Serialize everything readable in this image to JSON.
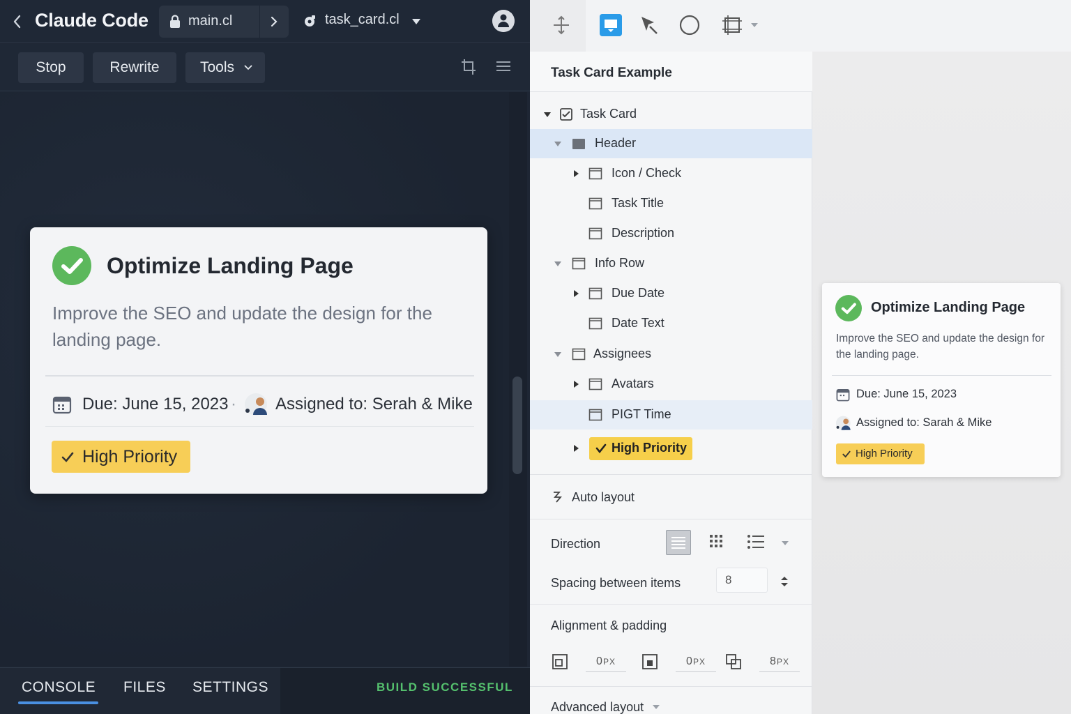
{
  "app": {
    "title": "Claude Code",
    "file_tab": "main.cl",
    "second_tab": "task_card.cl"
  },
  "toolbar": {
    "stop_label": "Stop",
    "rewrite_label": "Rewrite",
    "tools_label": "Tools"
  },
  "card": {
    "title": "Optimize Landing Page",
    "description": "Improve the SEO and update the design for the landing page.",
    "due": "Due: June 15, 2023",
    "separator": "·",
    "assigned": "Assigned to: Serah & Mike",
    "priority": "High Priority"
  },
  "bottom": {
    "tabs": [
      "CONSOLE",
      "FILES",
      "SETTINGS"
    ],
    "active_tab": "CONSOLE",
    "status": "BUILD SUCCESSFUL",
    "status_color": "#55c16e"
  },
  "layers_panel": {
    "title": "Task Card Example",
    "items": [
      {
        "label": "Task Card"
      },
      {
        "label": "Header"
      },
      {
        "label": "Icon / Check"
      },
      {
        "label": "Task Title"
      },
      {
        "label": "Description"
      },
      {
        "label": "Info Row"
      },
      {
        "label": "Due Date"
      },
      {
        "label": "Date Text"
      },
      {
        "label": "Assignees"
      },
      {
        "label": "Avatars"
      },
      {
        "label": "PIGT Time"
      },
      {
        "label": "High Priority"
      }
    ],
    "selected": "Header"
  },
  "properties": {
    "auto_layout_label": "Auto layout",
    "direction_label": "Direction",
    "spacing_label": "Spacing between items",
    "spacing_value": "8",
    "alignment_label": "Alignment & padding",
    "padding_values": [
      "0",
      "0",
      "8"
    ],
    "padding_unit": "PX",
    "advanced_label": "Advanced layout"
  },
  "preview_card": {
    "title": "Optimize Landing Page",
    "description": "Improve the SEO and update the design for the landing page.",
    "due": "Due: June 15, 2023",
    "assigned": "Assigned to: Sarah & Mike",
    "priority": "High Priority"
  },
  "colors": {
    "accent_blue": "#2a9be8",
    "success_green": "#5cb85c",
    "priority_yellow": "#f7ce57",
    "dark_bg": "#1e2634"
  },
  "icons": [
    "back-chevron-icon",
    "lock-icon",
    "chevron-right-icon",
    "gear-icon",
    "caret-down-icon",
    "user-icon",
    "crop-icon",
    "menu-icon",
    "check-circle-icon",
    "calendar-icon",
    "avatar-icon",
    "move-icon",
    "frame-icon",
    "pen-icon",
    "circle-icon",
    "auto-layout-icon"
  ]
}
